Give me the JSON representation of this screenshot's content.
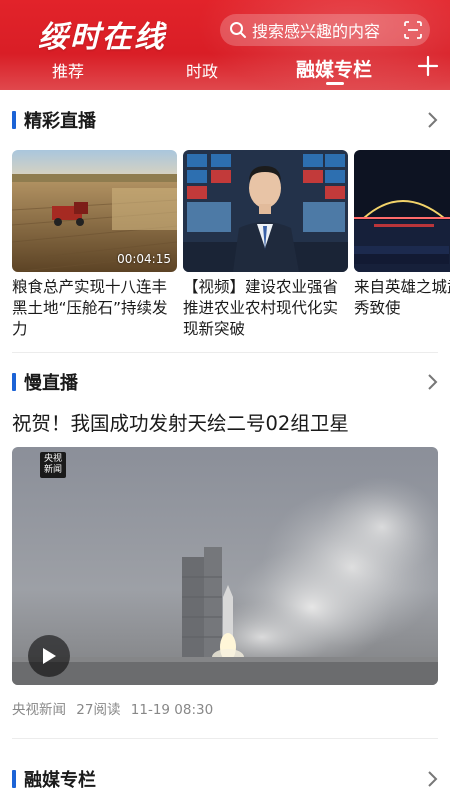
{
  "header": {
    "logo": "绥时在线",
    "search_placeholder": "搜索感兴趣的内容",
    "tabs": [
      {
        "label": "推荐"
      },
      {
        "label": "时政"
      },
      {
        "label": "融媒专栏"
      }
    ],
    "active_tab": "融媒专栏",
    "colors": {
      "brand": "#e2232a",
      "accent": "#1c63d6"
    },
    "icons": [
      "search-icon",
      "scan-icon",
      "plus-icon"
    ]
  },
  "sections": [
    {
      "title": "精彩直播"
    },
    {
      "title": "慢直播"
    },
    {
      "title": "融媒专栏"
    }
  ],
  "live_cards": [
    {
      "title": "粮食总产实现十八连丰黑土地“压舱石”持续发力",
      "duration": "00:04:15"
    },
    {
      "title": "【视频】建设农业强省推进农业农村现代化实现新突破"
    },
    {
      "title": "来自英雄之城武汉灯光秀致使"
    }
  ],
  "slow_live": {
    "headline": "祝贺！我国成功发射天绘二号02组卫星",
    "logo_text": "央视新闻",
    "source": "央视新闻",
    "reads": "27阅读",
    "time": "11-19 08:30"
  }
}
